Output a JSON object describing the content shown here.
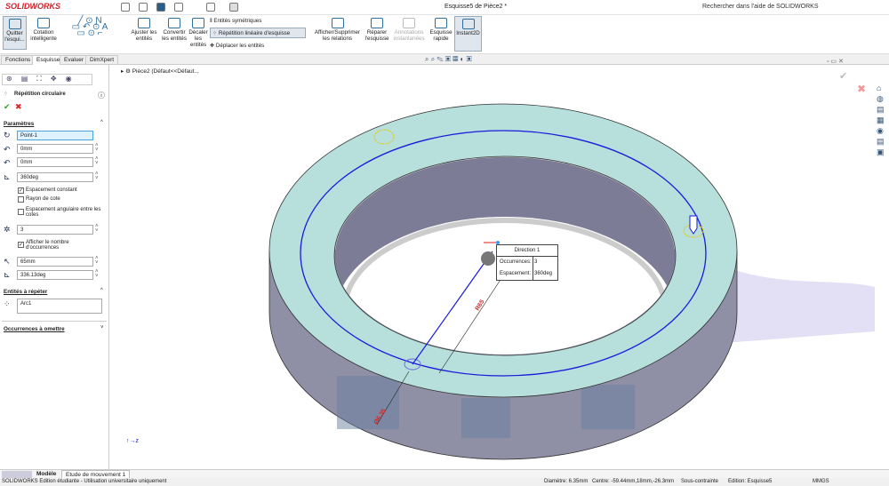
{
  "app": {
    "logo": "SOLIDWORKS",
    "title": "Esquisse5 de Pièce2 *",
    "help_search": "Rechercher dans l'aide de SOLIDWORKS"
  },
  "ribbon": {
    "quit": "Quitter l'esqui...",
    "cotation": "Cotation intelligente",
    "ajuster": "Ajuster les entités",
    "convertir": "Convertir les entités",
    "decaler": "Décaler les entités",
    "symetriques": "Entités symétriques",
    "repetition_lineaire": "Répétition linéaire d'esquisse",
    "deplacer": "Déplacer les entités",
    "relations": "Afficher/Supprimer les relations",
    "reparer": "Réparer l'esquisse",
    "annotations": "Annotations instantanées",
    "rapide": "Esquisse rapide",
    "instant2d": "Instant2D"
  },
  "tabs": [
    "Fonctions",
    "Esquisse",
    "Evaluer",
    "DimXpert"
  ],
  "tree": {
    "item": "Pièce2 (Défaut<<Défaut..."
  },
  "panel": {
    "title": "Répétition circulaire",
    "params_header": "Paramètres",
    "center": "Point-1",
    "x": "0mm",
    "y": "0mm",
    "angle": "360deg",
    "equal_spacing": "Espacement constant",
    "equal_spacing_checked": true,
    "dim_radius": "Rayon de cote",
    "dim_radius_checked": false,
    "dim_angular": "Espacement angulaire entre les cotes",
    "dim_angular_checked": false,
    "instances": "3",
    "show_count": "Afficher le nombre d'occurrences",
    "show_count_checked": true,
    "radius": "65mm",
    "arc_angle": "336.13deg",
    "entities_header": "Entités à répéter",
    "entity": "Arc1",
    "skip_header": "Occurrences à omettre"
  },
  "popup": {
    "title": "Direction 1",
    "occ_label": "Occurrences:",
    "occ_value": "3",
    "spacing_label": "Espacement:",
    "spacing_value": "360deg"
  },
  "dims": {
    "radius": "R65",
    "diameter": "Ø6.35"
  },
  "bottom_tabs": [
    "Modèle",
    "Etude de mouvement 1"
  ],
  "status": {
    "left": "SOLIDWORKS Edition étudiante - Utilisation universitaire uniquement",
    "diameter": "Diamètre: 6.35mm",
    "center": "Centre: -59.44mm,18mm,-26.3mm",
    "state": "Sous-contrainte",
    "edit": "Edition: Esquisse5",
    "units": "MMGS"
  },
  "colors": {
    "face": "#b7dfdc",
    "sketch": "#1a1adc",
    "accent": "#d0202a"
  }
}
